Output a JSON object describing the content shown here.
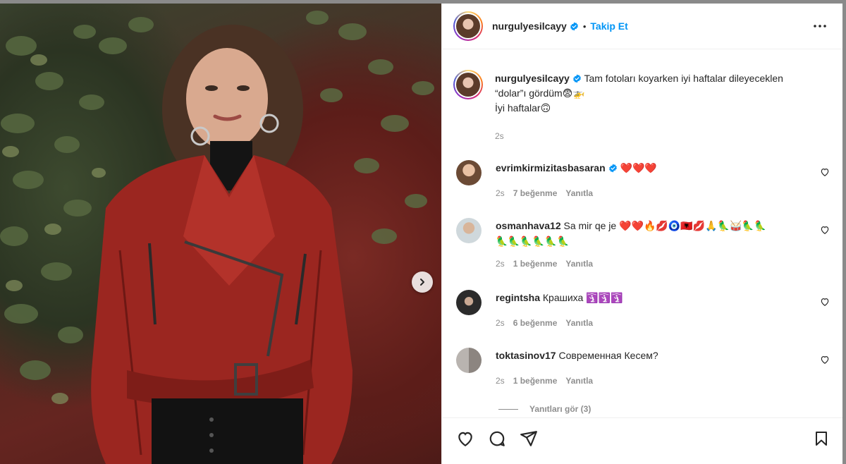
{
  "post": {
    "username": "nurgulyesilcayy",
    "follow_label": "Takip Et",
    "separator": "•",
    "caption_line1": "Tam fotoları koyarken iyi haftalar dileyeceklen",
    "caption_line2": "“dolar”ı gördüm😨🚁",
    "caption_line3": "İyi haftalar🙃",
    "caption_time": "2s"
  },
  "comments": [
    {
      "username": "evrimkirmizitasbasaran",
      "verified": true,
      "text": "❤️❤️❤️",
      "time": "2s",
      "likes": "7 beğenme",
      "reply": "Yanıtla"
    },
    {
      "username": "osmanhava12",
      "verified": false,
      "text": "Sa mir qe je ❤️❤️🔥💋🧿🇦🇱💋🙏🦜🥁🦜🦜",
      "text2": "🦜🦜🦜🦜🦜🦜",
      "time": "2s",
      "likes": "1 beğenme",
      "reply": "Yanıtla"
    },
    {
      "username": "regintsha",
      "verified": false,
      "text": "Крашиха 🛐🛐🛐",
      "time": "2s",
      "likes": "6 beğenme",
      "reply": "Yanıtla"
    },
    {
      "username": "toktasinov17",
      "verified": false,
      "text": "Современная Кесем?",
      "time": "2s",
      "likes": "1 beğenme",
      "reply": "Yanıtla"
    }
  ],
  "view_replies": "Yanıtları gör (3)",
  "colors": {
    "accent": "#0095f6",
    "text": "#262626",
    "muted": "#8e8e8e",
    "border": "#efefef"
  },
  "icons": {
    "header": [
      "verified-badge-icon",
      "more-options-icon"
    ],
    "actions": [
      "heart-icon",
      "comment-icon",
      "share-icon",
      "bookmark-icon"
    ],
    "photo": [
      "chevron-right-icon"
    ]
  }
}
